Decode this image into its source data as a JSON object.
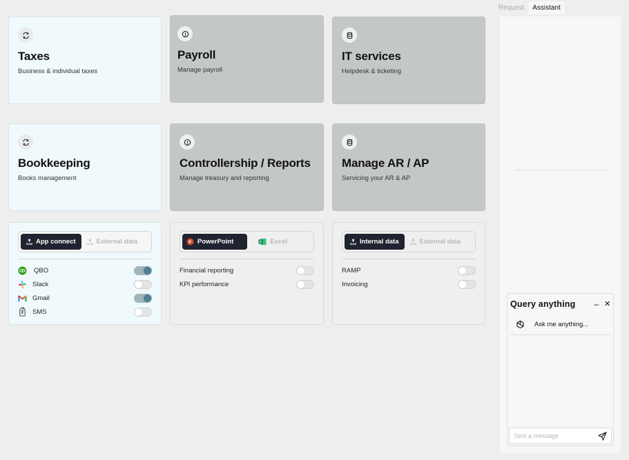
{
  "cards": [
    {
      "title": "Taxes",
      "subtitle": "Business & individual  taxes",
      "icon": "refresh-icon"
    },
    {
      "title": "Payroll",
      "subtitle": "Manage payroll",
      "icon": "alert-circle-icon"
    },
    {
      "title": "IT services",
      "subtitle": "Helpdesk & ticketing",
      "icon": "database-icon"
    },
    {
      "title": "Bookkeeping",
      "subtitle": "Books management",
      "icon": "refresh-icon"
    },
    {
      "title": "Controllership / Reports",
      "subtitle": "Manage treasury and reporting",
      "icon": "alert-circle-icon"
    },
    {
      "title": "Manage AR / AP",
      "subtitle": "Servicing your AR & AP",
      "icon": "database-icon"
    }
  ],
  "panels": {
    "apps": {
      "tab_active": "App connect",
      "tab_inactive": "External data",
      "rows": [
        {
          "label": "QBO",
          "on": true
        },
        {
          "label": "Slack",
          "on": false
        },
        {
          "label": "Gmail",
          "on": true
        },
        {
          "label": "SMS",
          "on": false
        }
      ]
    },
    "reports": {
      "tab_active": "PowerPoint",
      "tab_inactive": "Excel",
      "rows": [
        {
          "label": "Financial reporting",
          "on": false
        },
        {
          "label": "KPI performance",
          "on": false
        }
      ]
    },
    "data": {
      "tab_active": "Internal data",
      "tab_inactive": "External data",
      "rows": [
        {
          "label": "RAMP",
          "on": false
        },
        {
          "label": "Invoicing",
          "on": false
        }
      ]
    }
  },
  "sidebar": {
    "tabs": [
      "Request",
      "Assistant"
    ],
    "active_tab": "Assistant"
  },
  "query": {
    "title": "Query anything",
    "minimize": "–",
    "close": "×",
    "item": "Ask me anything...",
    "input_placeholder": "Sent a message"
  },
  "colors": {
    "light_card": "#f0f9fb",
    "gray_card": "#c4c7c8",
    "dark_button": "#1f2430",
    "toggle_on": "#4f7f93"
  }
}
